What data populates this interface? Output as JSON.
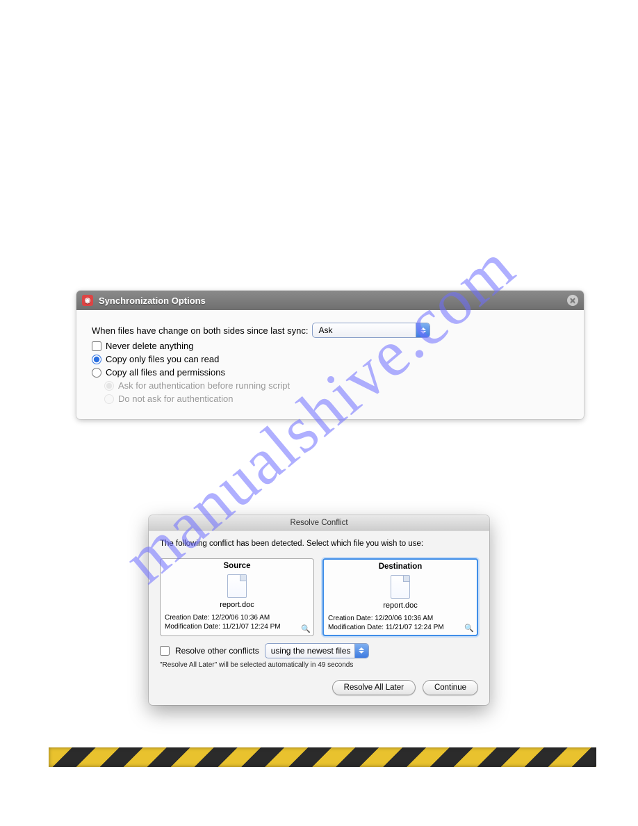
{
  "watermark": "manualshive.com",
  "sync": {
    "title": "Synchronization Options",
    "prompt": "When files have change on both sides since last sync:",
    "dropdown_value": "Ask",
    "never_delete": "Never delete anything",
    "copy_read": "Copy only files you can read",
    "copy_all": "Copy all files and permissions",
    "auth_ask": "Ask for authentication before running script",
    "auth_no": "Do not ask for authentication"
  },
  "conflict": {
    "title": "Resolve Conflict",
    "instructions": "The following conflict has been detected. Select which file you wish to use:",
    "source_label": "Source",
    "destination_label": "Destination",
    "filename": "report.doc",
    "creation": "Creation Date: 12/20/06 10:36 AM",
    "modification": "Modification Date: 11/21/07 12:24 PM",
    "resolve_other": "Resolve other conflicts",
    "resolve_dropdown": "using the newest files",
    "auto_note": "\"Resolve All Later\" will be selected automatically in 49 seconds",
    "btn_resolve_later": "Resolve All Later",
    "btn_continue": "Continue"
  }
}
